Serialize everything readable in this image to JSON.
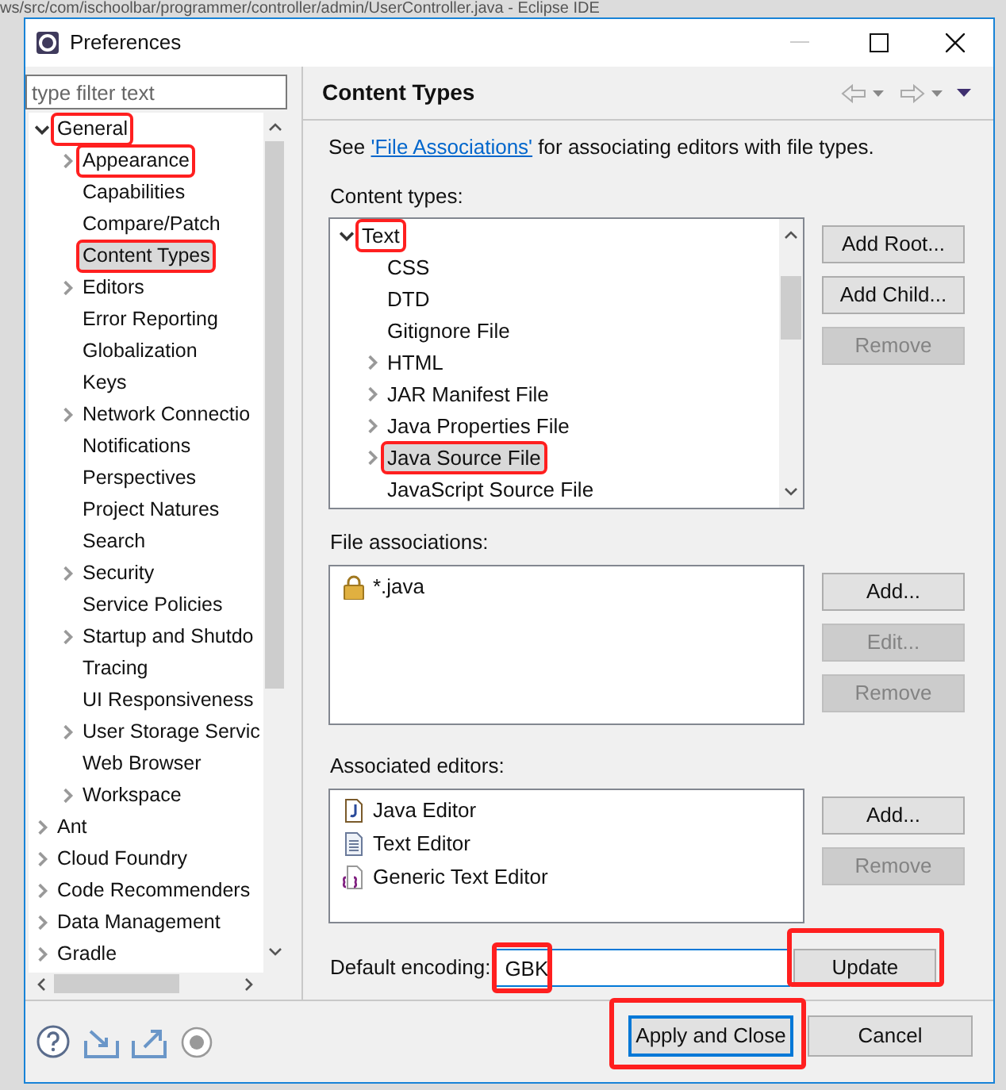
{
  "background_window": {
    "title": "ws/src/com/ischoolbar/programmer/controller/admin/UserController.java - Eclipse IDE"
  },
  "dialog": {
    "title": "Preferences",
    "filter": {
      "placeholder": "type filter text"
    },
    "tree": [
      {
        "label": "General",
        "expandable": true,
        "expanded": true,
        "selected": false,
        "highlighted": true,
        "children": [
          {
            "label": "Appearance",
            "expandable": true,
            "expanded": false,
            "selected": false,
            "highlighted": true
          },
          {
            "label": "Capabilities",
            "expandable": false,
            "selected": false,
            "highlighted": false
          },
          {
            "label": "Compare/Patch",
            "expandable": false,
            "selected": false,
            "highlighted": false
          },
          {
            "label": "Content Types",
            "expandable": false,
            "selected": true,
            "highlighted": true
          },
          {
            "label": "Editors",
            "expandable": true,
            "expanded": false,
            "selected": false,
            "highlighted": false
          },
          {
            "label": "Error Reporting",
            "expandable": false,
            "selected": false,
            "highlighted": false
          },
          {
            "label": "Globalization",
            "expandable": false,
            "selected": false,
            "highlighted": false
          },
          {
            "label": "Keys",
            "expandable": false,
            "selected": false,
            "highlighted": false
          },
          {
            "label": "Network Connectio",
            "expandable": true,
            "expanded": false,
            "selected": false,
            "highlighted": false
          },
          {
            "label": "Notifications",
            "expandable": false,
            "selected": false,
            "highlighted": false
          },
          {
            "label": "Perspectives",
            "expandable": false,
            "selected": false,
            "highlighted": false
          },
          {
            "label": "Project Natures",
            "expandable": false,
            "selected": false,
            "highlighted": false
          },
          {
            "label": "Search",
            "expandable": false,
            "selected": false,
            "highlighted": false
          },
          {
            "label": "Security",
            "expandable": true,
            "expanded": false,
            "selected": false,
            "highlighted": false
          },
          {
            "label": "Service Policies",
            "expandable": false,
            "selected": false,
            "highlighted": false
          },
          {
            "label": "Startup and Shutdo",
            "expandable": true,
            "expanded": false,
            "selected": false,
            "highlighted": false
          },
          {
            "label": "Tracing",
            "expandable": false,
            "selected": false,
            "highlighted": false
          },
          {
            "label": "UI Responsiveness",
            "expandable": false,
            "selected": false,
            "highlighted": false
          },
          {
            "label": "User Storage Servic",
            "expandable": true,
            "expanded": false,
            "selected": false,
            "highlighted": false
          },
          {
            "label": "Web Browser",
            "expandable": false,
            "selected": false,
            "highlighted": false
          },
          {
            "label": "Workspace",
            "expandable": true,
            "expanded": false,
            "selected": false,
            "highlighted": false
          }
        ]
      },
      {
        "label": "Ant",
        "expandable": true,
        "expanded": false,
        "selected": false,
        "highlighted": false
      },
      {
        "label": "Cloud Foundry",
        "expandable": true,
        "expanded": false,
        "selected": false,
        "highlighted": false
      },
      {
        "label": "Code Recommenders",
        "expandable": true,
        "expanded": false,
        "selected": false,
        "highlighted": false
      },
      {
        "label": "Data Management",
        "expandable": true,
        "expanded": false,
        "selected": false,
        "highlighted": false
      },
      {
        "label": "Gradle",
        "expandable": true,
        "expanded": false,
        "selected": false,
        "highlighted": false
      }
    ],
    "page": {
      "title": "Content Types",
      "intro": {
        "before": "See ",
        "link": "'File Associations'",
        "after": " for associating editors with file types."
      },
      "content_types": {
        "label": "Content types:",
        "tree": [
          {
            "label": "Text",
            "expandable": true,
            "expanded": true,
            "selected": false,
            "highlighted": true,
            "children": [
              {
                "label": "CSS",
                "expandable": false,
                "selected": false,
                "highlighted": false
              },
              {
                "label": "DTD",
                "expandable": false,
                "selected": false,
                "highlighted": false
              },
              {
                "label": "Gitignore File",
                "expandable": false,
                "selected": false,
                "highlighted": false
              },
              {
                "label": "HTML",
                "expandable": true,
                "expanded": false,
                "selected": false,
                "highlighted": false
              },
              {
                "label": "JAR Manifest File",
                "expandable": true,
                "expanded": false,
                "selected": false,
                "highlighted": false
              },
              {
                "label": "Java Properties File",
                "expandable": true,
                "expanded": false,
                "selected": false,
                "highlighted": false
              },
              {
                "label": "Java Source File",
                "expandable": true,
                "expanded": false,
                "selected": true,
                "highlighted": true
              },
              {
                "label": "JavaScript Source File",
                "expandable": false,
                "selected": false,
                "highlighted": false
              }
            ]
          }
        ],
        "buttons": [
          {
            "label": "Add Root...",
            "disabled": false
          },
          {
            "label": "Add Child...",
            "disabled": false
          },
          {
            "label": "Remove",
            "disabled": true
          }
        ]
      },
      "file_associations": {
        "label": "File associations:",
        "items": [
          {
            "label": "*.java",
            "kind": "locked"
          }
        ],
        "buttons": [
          {
            "label": "Add...",
            "disabled": false
          },
          {
            "label": "Edit...",
            "disabled": true
          },
          {
            "label": "Remove",
            "disabled": true
          }
        ]
      },
      "associated_editors": {
        "label": "Associated editors:",
        "items": [
          {
            "label": "Java Editor",
            "kind": "java"
          },
          {
            "label": "Text Editor",
            "kind": "text"
          },
          {
            "label": "Generic Text Editor",
            "kind": "generic"
          }
        ],
        "buttons": [
          {
            "label": "Add...",
            "disabled": false
          },
          {
            "label": "Remove",
            "disabled": true
          }
        ]
      },
      "encoding": {
        "label": "Default encoding:",
        "value": "GBK",
        "highlighted": true
      },
      "update_button": {
        "label": "Update",
        "highlighted": true
      }
    },
    "footer_buttons": [
      {
        "label": "Apply and Close",
        "default": true,
        "highlighted": true
      },
      {
        "label": "Cancel",
        "default": false,
        "highlighted": false
      }
    ]
  }
}
